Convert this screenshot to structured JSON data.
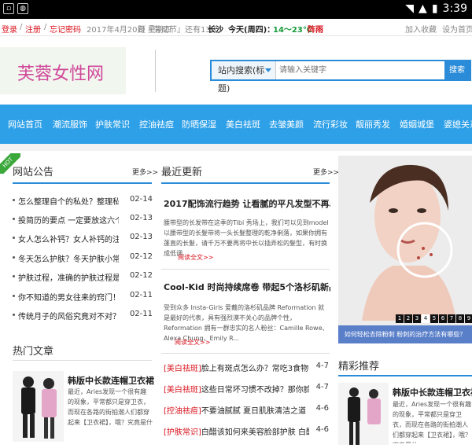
{
  "status_bar": {
    "time": "3:39"
  },
  "topbar": {
    "login": "登录",
    "sep1": "/",
    "register": "注册",
    "sep2": "/",
    "forgot": "忘记密码",
    "date": "2017年4月20日 星期四",
    "countdown_prefix": "距『劳动节』还有13天",
    "city": "长沙",
    "weather_label": "今天(周四)：",
    "temp": "14～23℃",
    "weather": "阵雨",
    "favorite": "加入收藏",
    "homepage": "设为首页"
  },
  "logo": {
    "text": "芙蓉女性网"
  },
  "search": {
    "scope": "站内搜索(标题)",
    "placeholder": "请输入关键字",
    "button": "搜索"
  },
  "nav": {
    "items": [
      "网站首页",
      "潮流服饰",
      "护肤常识",
      "控油祛痘",
      "防晒保湿",
      "美白祛斑",
      "去皱美颜",
      "流行彩妆",
      "靓丽秀发",
      "婚姻城堡",
      "婆媳关系"
    ]
  },
  "announcements": {
    "badge": "HOT",
    "title": "网站公告",
    "more": "更多>>",
    "items": [
      {
        "title": "怎么整理自个的私处？整理私处的",
        "date": "02-14"
      },
      {
        "title": "投简历的要点 一定要放这六个\"卖",
        "date": "02-13"
      },
      {
        "title": "女人怎么补钙？女人补钙的注意事",
        "date": "02-13"
      },
      {
        "title": "冬天怎么护肤？冬天护肤小常识",
        "date": "02-12"
      },
      {
        "title": "护肤过程，准确的护肤过程是什",
        "date": "02-12"
      },
      {
        "title": "你不知道的男女往来的窍门！",
        "date": "02-11"
      },
      {
        "title": "传统月子的风俗究竟对不对？准确",
        "date": "02-11"
      }
    ]
  },
  "latest": {
    "title": "最近更新",
    "more": "更多>>",
    "articles": [
      {
        "title": "2017配饰流行趋势 让看腻的平凡发型不再单调",
        "summary": "腰带型的长发带在这季的Tibi 秀场上，我们可以见到model以腰带型的长髮带将一头长髮整理的乾净俐落，如果你拥有蓬直的长髮，请千万不要再将中长以插弄松的髮型，有时换成低调...",
        "read": "阅读全文>>"
      },
      {
        "title": "Cool-Kid 时尚持续席卷 带起5个洛杉矶新品牌",
        "summary": "受到众多 Insta-Girls 爱戴的洛杉矶品牌 Reformation 就是最好的代表，具有强烈漠不关心的品牌个性，Reformation 拥有一群忠实的名人粉丝：Camille Rowe、Alexa Chung、Emily R...",
        "read": "阅读全文>>"
      }
    ],
    "news": [
      {
        "cat": "[美白祛斑]",
        "title": "脸上有斑点怎么办？常吃3食物能祛斑",
        "date": "4-7"
      },
      {
        "cat": "[美白祛斑]",
        "title": "这些日常坏习惯不改掉？那你脸上的斑",
        "date": "4-7"
      },
      {
        "cat": "[控油祛痘]",
        "title": "不要油腻腻 夏日肌肤清洁之道",
        "date": "4-6"
      },
      {
        "cat": "[护肤常识]",
        "title": "白醋该如何来美容脸部护肤 白醋美容护",
        "date": "4-6"
      }
    ]
  },
  "hot_articles": {
    "title": "热门文章",
    "item": {
      "title": "韩版中长款连帽卫衣裙*席",
      "summary": "最近，Aries发现一个很有趣的现象，平常都只是穿卫衣，而现在各路的街拍潮人们都穿起来【卫衣裙】，哦？究竟是什"
    }
  },
  "slider": {
    "numbers": [
      "1",
      "2",
      "3",
      "4",
      "5",
      "6",
      "7",
      "8",
      "9",
      "10",
      "11"
    ],
    "active_index": 3,
    "caption": "如何轻松去除粉刺 粉刺的治疗方法有哪些？"
  },
  "featured": {
    "title": "精彩推荐",
    "item": {
      "title": "韩版中长款连帽卫衣裙*席",
      "summary": "最近，Aries发现一个很有趣的现象，平常都只是穿卫衣，而现在各路的街拍潮人们都穿起来【卫衣裙】，哦？究竟是什"
    }
  },
  "colors": {
    "brand_blue": "#2ea0e8",
    "accent_red": "#d9121c",
    "logo_pink": "#d0489a"
  }
}
